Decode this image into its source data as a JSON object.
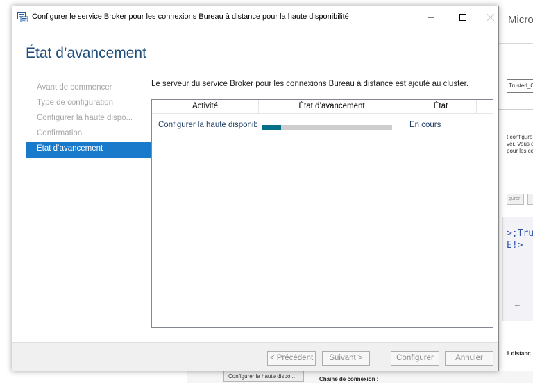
{
  "background": {
    "title": "Microso",
    "input_value": "Trusted_Co",
    "paragraph": [
      "t configuré",
      "ver. Vous d",
      "pour les co"
    ],
    "button_label": "gurer",
    "code_lines": [
      ">;Tru",
      "E!>"
    ],
    "dash": "–",
    "bottom_right_label": "à distanc",
    "bottom_tab_label": "Configurer la haute dispo...",
    "bottom_label": "Chaîne de connexion :"
  },
  "dialog": {
    "title": "Configurer le service Broker pour les connexions Bureau à distance pour la haute disponibilité",
    "heading": "État d’avancement",
    "sidebar": [
      {
        "label": "Avant de commencer",
        "active": false
      },
      {
        "label": "Type de configuration",
        "active": false
      },
      {
        "label": "Configurer la haute dispo...",
        "active": false
      },
      {
        "label": "Confirmation",
        "active": false
      },
      {
        "label": "État d’avancement",
        "active": true
      }
    ],
    "intro": "Le serveur du service Broker pour les connexions Bureau à distance est ajouté au cluster.",
    "table": {
      "columns": [
        "Activité",
        "État d’avancement",
        "État"
      ],
      "rows": [
        {
          "activity": "Configurer la haute disponibilité",
          "progress": 0.15,
          "state": "En cours"
        }
      ]
    },
    "buttons": {
      "previous": "< Précédent",
      "next": "Suivant >",
      "configure": "Configurer",
      "cancel": "Annuler"
    }
  },
  "colors": {
    "accent": "#1979ca",
    "heading": "#1e4e79",
    "progress": "#056e8a"
  }
}
